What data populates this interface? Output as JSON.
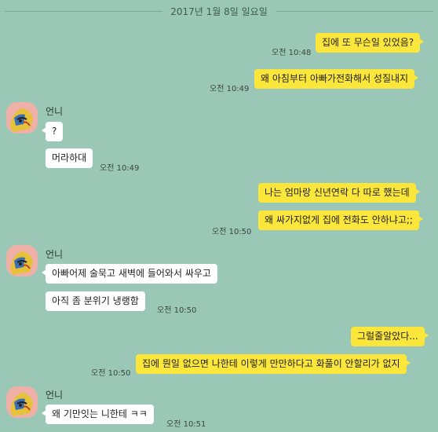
{
  "date_divider": "2017년 1월 8일 일요일",
  "contact_name": "언니",
  "messages": {
    "m1": {
      "text": "집에 또 무슨일 있었음?",
      "time": "오전 10:48"
    },
    "m2": {
      "text": "왜 아침부터 아빠가전화해서 성질내지",
      "time": "오전 10:49"
    },
    "m3": {
      "text": "?"
    },
    "m4": {
      "text": "머라하대",
      "time": "오전 10:49"
    },
    "m5": {
      "text": "나는 엄마랑 신년연락 다 따로 했는데"
    },
    "m6": {
      "text": "왜 싸가지없게 집에 전화도 안하냐고;;",
      "time": "오전 10:50"
    },
    "m7": {
      "text": "아빠어제 술묵고 새벽에 들어와서 싸우고"
    },
    "m8": {
      "text": "아직 좀 분위기 냉랭함",
      "time": "오전 10:50"
    },
    "m9": {
      "text": "그럴줄알았다..."
    },
    "m10": {
      "text": "집에 뭔일 없으면 나한테 이렇게 만만하다고 화풀이 안할리가 없지",
      "time": "오전 10:50"
    },
    "m11": {
      "text": "왜 기만잇는 니한테 ㅋㅋ",
      "time": "오전 10:51"
    }
  },
  "colors": {
    "background": "#9bc8b6",
    "my_bubble": "#fbe63b",
    "other_bubble": "#ffffff"
  },
  "icons": {
    "avatar": "profile-avatar-pop-art"
  }
}
